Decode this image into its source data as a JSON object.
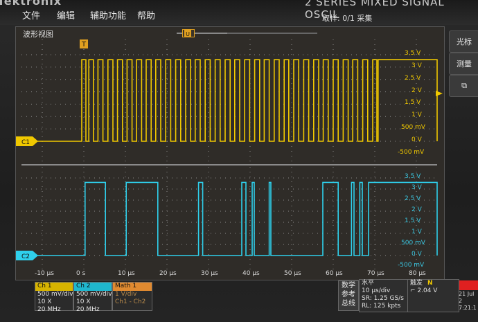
{
  "header": {
    "brand": "Tektronix",
    "series": "2 SERIES   MIXED SIGNAL OSCIL",
    "acquisition": "取样: 0/1 采集"
  },
  "menu": [
    {
      "label": "文件"
    },
    {
      "label": "编辑"
    },
    {
      "label": "辅助功能"
    },
    {
      "label": "帮助"
    }
  ],
  "waveform_view": {
    "title": "波形视图",
    "trigger_marker": "T",
    "position_marker": "U",
    "ch1_label": "C1",
    "ch2_label": "C2"
  },
  "y_ticks_ch1": [
    "3.5 V",
    "3 V",
    "2.5 V",
    "2 V",
    "1.5 V",
    "1 V",
    "500 mV",
    "0 V",
    "-500 mV"
  ],
  "y_ticks_ch2": [
    "3.5 V",
    "3 V",
    "2.5 V",
    "2 V",
    "1.5 V",
    "1 V",
    "500 mV",
    "0 V",
    "-500 mV"
  ],
  "x_ticks": [
    "-10 μs",
    "0 s",
    "10 μs",
    "20 μs",
    "30 μs",
    "40 μs",
    "50 μs",
    "60 μs",
    "70 μs",
    "80 μs"
  ],
  "side_buttons": [
    {
      "label": "光标"
    },
    {
      "label": "测量"
    },
    {
      "label": "⧉"
    }
  ],
  "channels": {
    "ch1": {
      "name": "Ch 1",
      "scale": "500 mV/div",
      "probe": "10 X",
      "bw": "20 MHz"
    },
    "ch2": {
      "name": "Ch 2",
      "scale": "500 mV/div",
      "probe": "10 X",
      "bw": "20 MHz"
    },
    "math": {
      "name": "Math 1",
      "scale": "1 V/div",
      "expr": "Ch1 - Ch2"
    }
  },
  "math_ref": {
    "line1": "数学",
    "line2": "参考",
    "line3": "总线"
  },
  "horizontal": {
    "title": "水平",
    "scale": "10 μs/div",
    "sr": "SR: 1.25 GS/s",
    "rl": "RL: 125 kpts"
  },
  "trigger": {
    "title": "触发",
    "mode": "N",
    "level": "2.04 V"
  },
  "datetime": {
    "date": "21 Jul 2",
    "time": "7:21:1"
  },
  "colors": {
    "ch1": "#f0c800",
    "ch2": "#2fd0ec",
    "accent": "#e08a30",
    "grid": "#8c8c8c"
  },
  "chart_data": {
    "type": "line",
    "x_unit": "μs",
    "xlim": [
      -15,
      85
    ],
    "series": [
      {
        "name": "C1",
        "low": 0,
        "high": 3.3,
        "edges": [
          -15,
          -3,
          -0.5,
          0.5,
          1.2,
          2.3,
          3.4,
          4.6,
          5.8,
          7,
          8.1,
          9.3,
          10.4,
          11.6,
          12.7,
          13.9,
          15,
          16.2,
          17.3,
          18.5,
          19.7,
          20.9,
          22.1,
          23.3,
          24.5,
          25.7,
          26.8,
          28,
          29.2,
          30.4,
          31.6,
          32.8,
          34,
          35.2,
          36.3,
          37.5,
          38.7,
          39.9,
          41.1,
          42.3,
          43.4,
          44.6,
          45.8,
          47,
          48.2,
          49.3,
          50.5,
          51.7,
          52.9,
          54.1,
          55.3,
          56.5,
          57.6,
          58.8,
          60,
          61.2,
          62.4,
          63.6,
          64.7,
          65.9,
          67.1,
          68.3,
          69.5,
          70.5,
          70.8,
          85
        ]
      },
      {
        "name": "C2",
        "low": 0,
        "high": 3.3,
        "edges": [
          -15,
          -1,
          0.3,
          5.2,
          10.2,
          17.8,
          27.6,
          28.6,
          38,
          39,
          40.5,
          41,
          44.6,
          45,
          57.5,
          61.2,
          64.4,
          65,
          66.4,
          67,
          68.5,
          85
        ]
      }
    ]
  }
}
